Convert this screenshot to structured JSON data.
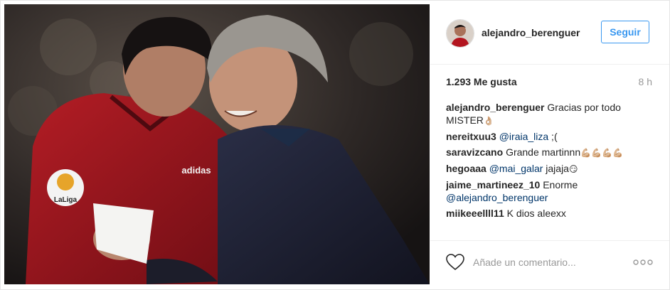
{
  "post": {
    "username": "alejandro_berenguer",
    "follow_label": "Seguir",
    "likes": "1.293 Me gusta",
    "time": "8 h",
    "add_comment_placeholder": "Añade un comentario...",
    "more_icon": "ellipsis-icon",
    "heart_icon": "heart-outline-icon",
    "accent_color": "#3897f0"
  },
  "comments": [
    {
      "user": "alejandro_berenguer",
      "text": "Gracias por todo MISTER",
      "emoji": "👌🏼"
    },
    {
      "user": "nereitxuu3",
      "mention": "@iraia_liza",
      "text": " ;("
    },
    {
      "user": "saravizcano",
      "text": "Grande martinnn",
      "emoji": "💪🏼💪🏼💪🏼💪🏼"
    },
    {
      "user": "hegoaaa",
      "mention": "@mai_galar",
      "text": " jajaja",
      "emoji": "😏"
    },
    {
      "user": "jaime_martineez_10",
      "text": "Enorme ",
      "mention_after": "@alejandro_berenguer"
    },
    {
      "user": "miikeeellll11",
      "text": "K dios aleexx"
    }
  ],
  "photo": {
    "jersey_brand": "adidas",
    "sleeve_badge": "LaLiga"
  }
}
